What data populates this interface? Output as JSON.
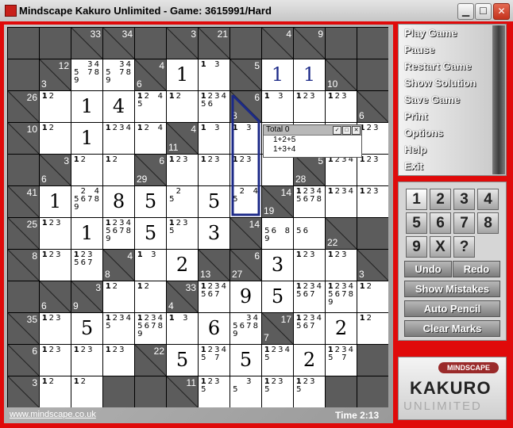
{
  "window": {
    "title": "Mindscape Kakuro Unlimited - Game:  3615991/Hard",
    "controls": {
      "minimize": "minimize-icon",
      "maximize": "maximize-icon",
      "close": "close-icon"
    }
  },
  "board": {
    "rows": [
      [
        {
          "t": "b"
        },
        {
          "t": "b"
        },
        {
          "t": "c",
          "h": 33
        },
        {
          "t": "c",
          "h": 34
        },
        {
          "t": "b"
        },
        {
          "t": "c",
          "h": 3
        },
        {
          "t": "c",
          "h": 21
        },
        {
          "t": "b"
        },
        {
          "t": "c",
          "h": 4
        },
        {
          "t": "c",
          "h": 9
        },
        {
          "t": "b"
        },
        {
          "t": "b"
        }
      ],
      [
        {
          "t": "b"
        },
        {
          "t": "c",
          "v": 3,
          "h": 12
        },
        {
          "t": "w",
          "pm": [
            "",
            "",
            "3",
            "4",
            "5",
            "",
            "7",
            "8",
            "9"
          ],
          "bold": []
        },
        {
          "t": "w",
          "pm": [
            "",
            "",
            "3",
            "4",
            "5",
            "",
            "7",
            "8",
            "9"
          ],
          "bold": []
        },
        {
          "t": "c",
          "v": 6,
          "h": 4
        },
        {
          "t": "w",
          "big": "1"
        },
        {
          "t": "w",
          "pm": [
            "1",
            "",
            "3"
          ],
          "bold": [
            "1"
          ]
        },
        {
          "t": "c",
          "h": 5
        },
        {
          "t": "w",
          "big": "1",
          "blue": true
        },
        {
          "t": "w",
          "big": "1",
          "blue": true
        },
        {
          "t": "c",
          "v": 10
        },
        {
          "t": "b"
        }
      ],
      [
        {
          "t": "c",
          "h": 26
        },
        {
          "t": "w",
          "pm": [
            "1",
            "2"
          ],
          "bold": [
            "1"
          ]
        },
        {
          "t": "w",
          "big": "1"
        },
        {
          "t": "w",
          "big": "4"
        },
        {
          "t": "w",
          "pm": [
            "1",
            "2",
            "",
            "4",
            "5"
          ],
          "bold": [
            "1"
          ]
        },
        {
          "t": "w",
          "pm": [
            "1",
            "2"
          ],
          "bold": [
            "1"
          ]
        },
        {
          "t": "w",
          "pm": [
            "1",
            "2",
            "3",
            "4",
            "5",
            "6"
          ],
          "bold": [
            "1"
          ]
        },
        {
          "t": "c",
          "v": 8,
          "h": 6
        },
        {
          "t": "w",
          "pm": [
            "1",
            "",
            "3"
          ],
          "bold": [
            "1"
          ]
        },
        {
          "t": "w",
          "pm": [
            "1",
            "2",
            "3"
          ],
          "bold": [
            "1"
          ]
        },
        {
          "t": "w",
          "pm": [
            "1",
            "2",
            "3"
          ],
          "bold": [
            "1"
          ]
        },
        {
          "t": "c",
          "v": 6
        }
      ],
      [
        {
          "t": "c",
          "h": 10
        },
        {
          "t": "w",
          "pm": [
            "1",
            "2"
          ],
          "bold": [
            "1"
          ]
        },
        {
          "t": "w",
          "big": "1"
        },
        {
          "t": "w",
          "pm": [
            "1",
            "2",
            "3",
            "4"
          ],
          "bold": [
            "1"
          ]
        },
        {
          "t": "w",
          "pm": [
            "1",
            "2",
            "",
            "4"
          ],
          "bold": [
            "1"
          ]
        },
        {
          "t": "c",
          "v": 11,
          "h": 4
        },
        {
          "t": "w",
          "pm": [
            "1",
            "",
            "3"
          ],
          "bold": [
            "1"
          ]
        },
        {
          "t": "w",
          "pm": [
            "1",
            "",
            "3"
          ],
          "bold": [
            "1"
          ]
        },
        {
          "t": "w",
          "pm": [],
          "bold": []
        },
        {
          "t": "w",
          "pm": [
            "1",
            "2",
            "3"
          ],
          "bold": [
            "1"
          ]
        },
        {
          "t": "w",
          "pm": [
            "1",
            "2",
            "3"
          ],
          "bold": [
            "1"
          ]
        },
        {
          "t": "w",
          "pm": [
            "1",
            "2",
            "3"
          ],
          "bold": [
            "1"
          ]
        }
      ],
      [
        {
          "t": "b"
        },
        {
          "t": "c",
          "v": 6,
          "h": 3
        },
        {
          "t": "w",
          "pm": [
            "1",
            "2"
          ],
          "bold": [
            "1"
          ]
        },
        {
          "t": "w",
          "pm": [
            "1",
            "2"
          ],
          "bold": [
            "1"
          ]
        },
        {
          "t": "c",
          "v": 29,
          "h": 6
        },
        {
          "t": "w",
          "pm": [
            "1",
            "2",
            "3"
          ],
          "bold": [
            "1"
          ]
        },
        {
          "t": "w",
          "pm": [
            "1",
            "2",
            "3"
          ],
          "bold": [
            "1"
          ]
        },
        {
          "t": "w",
          "pm": [
            "1",
            "2",
            "3"
          ],
          "bold": [
            "1"
          ]
        },
        {
          "t": "w",
          "pm": [],
          "bold": []
        },
        {
          "t": "c",
          "v": 28,
          "h": 5
        },
        {
          "t": "w",
          "pm": [
            "1",
            "2",
            "3",
            "4"
          ],
          "bold": [
            "1"
          ]
        },
        {
          "t": "w",
          "pm": [
            "1",
            "2",
            "3"
          ],
          "bold": [
            "1"
          ]
        }
      ],
      [
        {
          "t": "c",
          "h": 41
        },
        {
          "t": "w",
          "big": "1"
        },
        {
          "t": "w",
          "pm": [
            "",
            "2",
            "",
            "4",
            "5",
            "6",
            "7",
            "8",
            "9"
          ],
          "bold": []
        },
        {
          "t": "w",
          "big": "8"
        },
        {
          "t": "w",
          "big": "5"
        },
        {
          "t": "w",
          "pm": [
            "",
            "2",
            "",
            "",
            "5"
          ],
          "bold": []
        },
        {
          "t": "w",
          "big": "5"
        },
        {
          "t": "w",
          "pm": [
            "",
            "2",
            "",
            "4",
            "5"
          ],
          "bold": []
        },
        {
          "t": "c",
          "v": 19,
          "h": 14
        },
        {
          "t": "w",
          "pm": [
            "1",
            "2",
            "3",
            "4",
            "5",
            "6",
            "7",
            "8"
          ],
          "bold": [
            "1"
          ]
        },
        {
          "t": "w",
          "pm": [
            "1",
            "2",
            "3",
            "4"
          ],
          "bold": [
            "1"
          ]
        },
        {
          "t": "w",
          "pm": [
            "1",
            "2",
            "3"
          ],
          "bold": [
            "1"
          ]
        }
      ],
      [
        {
          "t": "c",
          "h": 25
        },
        {
          "t": "w",
          "pm": [
            "1",
            "2",
            "3"
          ],
          "bold": [
            "1"
          ]
        },
        {
          "t": "w",
          "big": "1"
        },
        {
          "t": "w",
          "pm": [
            "1",
            "2",
            "3",
            "4",
            "5",
            "6",
            "7",
            "8",
            "9"
          ],
          "bold": [
            "1"
          ]
        },
        {
          "t": "w",
          "big": "5"
        },
        {
          "t": "w",
          "pm": [
            "1",
            "2",
            "3",
            "",
            "5"
          ],
          "bold": [
            "1"
          ]
        },
        {
          "t": "w",
          "big": "3"
        },
        {
          "t": "c",
          "h": 14
        },
        {
          "t": "w",
          "pm": [
            "",
            "",
            "",
            "",
            "5",
            "6",
            "",
            "8",
            "9"
          ],
          "bold": []
        },
        {
          "t": "w",
          "pm": [
            "",
            "",
            "",
            "",
            "5",
            "6"
          ],
          "bold": []
        },
        {
          "t": "c",
          "v": 22
        },
        {
          "t": "b"
        }
      ],
      [
        {
          "t": "c",
          "h": 8
        },
        {
          "t": "w",
          "pm": [
            "1",
            "2",
            "3"
          ],
          "bold": [
            "1"
          ]
        },
        {
          "t": "w",
          "pm": [
            "1",
            "2",
            "3",
            "",
            "5",
            "6",
            "7"
          ],
          "bold": [
            "1"
          ]
        },
        {
          "t": "c",
          "v": 8,
          "h": 4
        },
        {
          "t": "w",
          "pm": [
            "1",
            "",
            "3"
          ],
          "bold": [
            "1"
          ]
        },
        {
          "t": "w",
          "big": "2"
        },
        {
          "t": "c",
          "v": 13
        },
        {
          "t": "c",
          "v": 27,
          "h": 6
        },
        {
          "t": "w",
          "big": "3"
        },
        {
          "t": "w",
          "pm": [
            "1",
            "2",
            "3"
          ],
          "bold": [
            "1"
          ]
        },
        {
          "t": "w",
          "pm": [
            "1",
            "2",
            "3"
          ],
          "bold": [
            "1"
          ]
        },
        {
          "t": "c",
          "v": 3
        }
      ],
      [
        {
          "t": "b"
        },
        {
          "t": "c",
          "v": 6
        },
        {
          "t": "c",
          "v": 9,
          "h": 3
        },
        {
          "t": "w",
          "pm": [
            "1",
            "2"
          ],
          "bold": [
            "1"
          ]
        },
        {
          "t": "w",
          "pm": [
            "1",
            "2"
          ],
          "bold": [
            "1"
          ]
        },
        {
          "t": "c",
          "v": 4,
          "h": 33
        },
        {
          "t": "w",
          "pm": [
            "1",
            "2",
            "3",
            "4",
            "5",
            "6",
            "7"
          ],
          "bold": [
            "1"
          ]
        },
        {
          "t": "w",
          "big": "9"
        },
        {
          "t": "w",
          "big": "5"
        },
        {
          "t": "w",
          "pm": [
            "1",
            "2",
            "3",
            "4",
            "5",
            "6",
            "7"
          ],
          "bold": [
            "1"
          ]
        },
        {
          "t": "w",
          "pm": [
            "1",
            "2",
            "3",
            "4",
            "5",
            "6",
            "7",
            "8",
            "9"
          ],
          "bold": [
            "1"
          ]
        },
        {
          "t": "w",
          "pm": [
            "1",
            "2"
          ],
          "bold": [
            "1"
          ]
        }
      ],
      [
        {
          "t": "c",
          "h": 35
        },
        {
          "t": "w",
          "pm": [
            "1",
            "2",
            "3"
          ],
          "bold": [
            "1"
          ]
        },
        {
          "t": "w",
          "big": "5"
        },
        {
          "t": "w",
          "pm": [
            "1",
            "2",
            "3",
            "4",
            "5"
          ],
          "bold": [
            "1"
          ]
        },
        {
          "t": "w",
          "pm": [
            "1",
            "2",
            "3",
            "4",
            "5",
            "6",
            "7",
            "8",
            "9"
          ],
          "bold": [
            "1"
          ]
        },
        {
          "t": "w",
          "pm": [
            "1",
            "",
            "3"
          ],
          "bold": [
            "1"
          ]
        },
        {
          "t": "w",
          "big": "6"
        },
        {
          "t": "w",
          "pm": [
            "",
            "",
            "3",
            "4",
            "5",
            "6",
            "7",
            "8",
            "9"
          ],
          "bold": []
        },
        {
          "t": "c",
          "v": 7,
          "h": 17
        },
        {
          "t": "w",
          "pm": [
            "1",
            "2",
            "3",
            "4",
            "5",
            "6",
            "7"
          ],
          "bold": [
            "1"
          ]
        },
        {
          "t": "w",
          "big": "2"
        },
        {
          "t": "w",
          "pm": [
            "1",
            "2"
          ],
          "bold": [
            "1"
          ]
        }
      ],
      [
        {
          "t": "c",
          "h": 6
        },
        {
          "t": "w",
          "pm": [
            "1",
            "2",
            "3"
          ],
          "bold": [
            "1"
          ]
        },
        {
          "t": "w",
          "pm": [
            "1",
            "2",
            "3"
          ],
          "bold": [
            "1"
          ]
        },
        {
          "t": "w",
          "pm": [
            "1",
            "2",
            "3"
          ],
          "bold": [
            "1"
          ]
        },
        {
          "t": "c",
          "h": 22
        },
        {
          "t": "w",
          "big": "5"
        },
        {
          "t": "w",
          "pm": [
            "1",
            "2",
            "3",
            "4",
            "5",
            "",
            "7"
          ],
          "bold": [
            "1"
          ]
        },
        {
          "t": "w",
          "big": "5"
        },
        {
          "t": "w",
          "pm": [
            "1",
            "2",
            "3",
            "4",
            "5"
          ],
          "bold": [
            "1"
          ]
        },
        {
          "t": "w",
          "big": "2"
        },
        {
          "t": "w",
          "pm": [
            "1",
            "2",
            "3",
            "4",
            "5",
            "",
            "7"
          ],
          "bold": [
            "1"
          ]
        },
        {
          "t": "b"
        }
      ],
      [
        {
          "t": "c",
          "h": 3
        },
        {
          "t": "w",
          "pm": [
            "1",
            "2"
          ],
          "bold": [
            "1"
          ]
        },
        {
          "t": "w",
          "pm": [
            "1",
            "2"
          ],
          "bold": [
            "1"
          ]
        },
        {
          "t": "b"
        },
        {
          "t": "b"
        },
        {
          "t": "c",
          "h": 11
        },
        {
          "t": "w",
          "pm": [
            "1",
            "2",
            "3",
            "",
            "5"
          ],
          "bold": [
            "1"
          ]
        },
        {
          "t": "w",
          "pm": [
            "",
            "",
            "3",
            "",
            "5"
          ],
          "bold": []
        },
        {
          "t": "w",
          "pm": [
            "1",
            "2",
            "3",
            "",
            "5"
          ],
          "bold": [
            "1"
          ]
        },
        {
          "t": "w",
          "pm": [
            "1",
            "2",
            "3",
            "",
            "5"
          ],
          "bold": [
            "1"
          ]
        },
        {
          "t": "b"
        },
        {
          "t": "b"
        }
      ]
    ]
  },
  "popup": {
    "title": "Total  0",
    "lines": [
      "1+2+5",
      "1+3+4"
    ]
  },
  "footer": {
    "link": "www.mindscape.co.uk",
    "time": "Time 2:13"
  },
  "menu": {
    "items": [
      "Play Game",
      "Pause",
      "Restart Game",
      "Show Solution",
      "Save Game",
      "Print",
      "Options",
      "Help",
      "Exit"
    ]
  },
  "keypad": {
    "numbers": [
      "1",
      "2",
      "3",
      "4",
      "5",
      "6",
      "7",
      "8",
      "9",
      "X",
      "?"
    ],
    "active": "1",
    "undo": "Undo",
    "redo": "Redo",
    "show_mistakes": "Show Mistakes",
    "auto_pencil": "Auto Pencil",
    "clear_marks": "Clear Marks"
  },
  "logo": {
    "brand": "MINDSCAPE",
    "name": "KAKURO",
    "sub": "UNLIMITED"
  },
  "colors": {
    "frame": "#e00a0a",
    "blue_digit": "#1c2a88",
    "clue_cell": "#5c5c5c"
  }
}
